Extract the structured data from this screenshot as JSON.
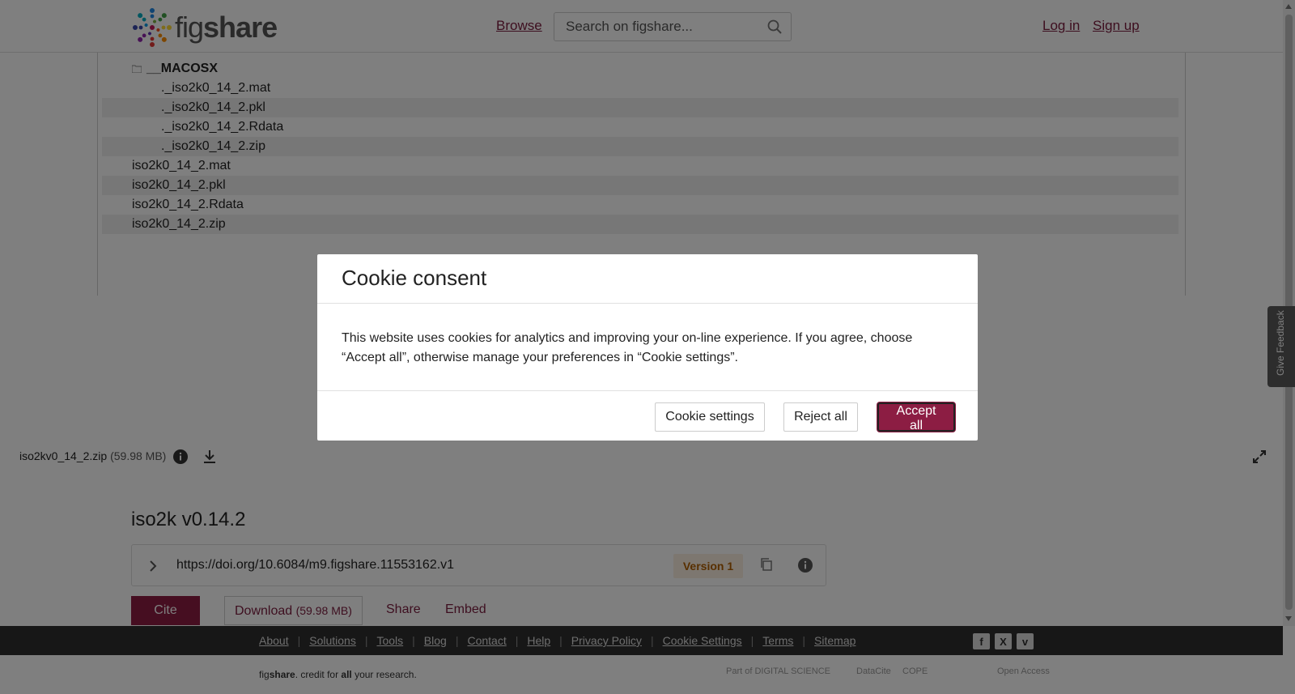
{
  "header": {
    "logo_text_a": "fig",
    "logo_text_b": "share",
    "browse": "Browse",
    "search_placeholder": "Search on figshare...",
    "login": "Log in",
    "signup": "Sign up"
  },
  "tree": {
    "folder": "__MACOSX",
    "children": [
      "._iso2k0_14_2.mat",
      "._iso2k0_14_2.pkl",
      "._iso2k0_14_2.Rdata",
      "._iso2k0_14_2.zip"
    ],
    "files": [
      "iso2k0_14_2.mat",
      "iso2k0_14_2.pkl",
      "iso2k0_14_2.Rdata",
      "iso2k0_14_2.zip"
    ]
  },
  "filebar": {
    "name": "iso2kv0_14_2.zip",
    "size": "(59.98 MB)"
  },
  "item": {
    "title": "iso2k v0.14.2",
    "doi": "https://doi.org/10.6084/m9.figshare.11553162.v1",
    "version": "Version 1",
    "cite": "Cite",
    "download": "Download",
    "download_size": "(59.98 MB)",
    "share": "Share",
    "embed": "Embed"
  },
  "footer": {
    "links": [
      "About",
      "Solutions",
      "Tools",
      "Blog",
      "Contact",
      "Help",
      "Privacy Policy",
      "Cookie Settings",
      "Terms",
      "Sitemap"
    ],
    "tagline_a": "fig",
    "tagline_b": "share",
    "tagline_c": ". credit for ",
    "tagline_d": "all",
    "tagline_e": " your research.",
    "social": [
      "f",
      "X",
      "v"
    ],
    "partners": [
      "Part of DIGITAL SCIENCE",
      "DataCite",
      "COPE",
      "Open Access"
    ]
  },
  "feedback": "Give Feedback",
  "modal": {
    "title": "Cookie consent",
    "body": "This website uses cookies for analytics and improving your on-line experience. If you agree, choose “Accept all”, otherwise manage your preferences in “Cookie settings”.",
    "settings": "Cookie settings",
    "reject": "Reject all",
    "accept": "Accept all"
  },
  "colors": {
    "brand": "#8c1d43",
    "link": "#7b1c3e",
    "version_bg": "#fbeee0",
    "version_fg": "#b15f00"
  }
}
